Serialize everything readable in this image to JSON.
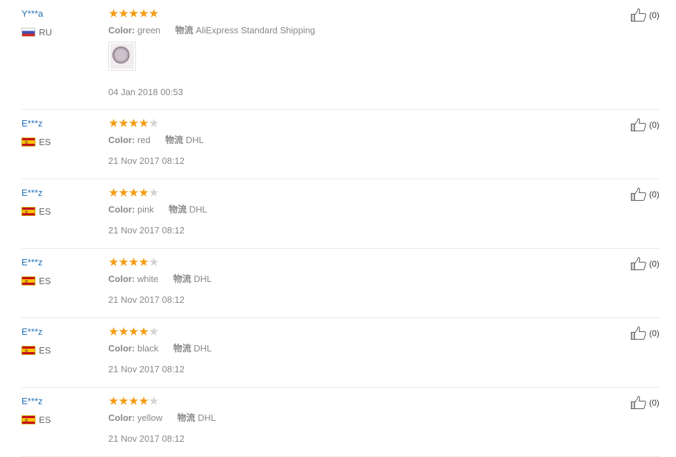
{
  "colors": {
    "accent_link": "#1f6fb6",
    "star_filled": "#f39c12",
    "star_empty": "#d4d4d4",
    "divider": "#e8e8e8"
  },
  "icons": {
    "helpful": "thumbs-up-icon",
    "photo": "review-photo",
    "star": "star-icon"
  },
  "reviews": [
    {
      "user": "Y***a",
      "country": "RU",
      "rating": 5,
      "color_label": "Color:",
      "color_value": "green",
      "shipping_label": "物流",
      "shipping_value": "AliExpress Standard Shipping",
      "date": "04 Jan 2018 00:53",
      "helpful": "(0)",
      "has_photo": true
    },
    {
      "user": "E***z",
      "country": "ES",
      "rating": 4,
      "color_label": "Color:",
      "color_value": "red",
      "shipping_label": "物流",
      "shipping_value": "DHL",
      "date": "21 Nov 2017 08:12",
      "helpful": "(0)",
      "has_photo": false
    },
    {
      "user": "E***z",
      "country": "ES",
      "rating": 4,
      "color_label": "Color:",
      "color_value": "pink",
      "shipping_label": "物流",
      "shipping_value": "DHL",
      "date": "21 Nov 2017 08:12",
      "helpful": "(0)",
      "has_photo": false
    },
    {
      "user": "E***z",
      "country": "ES",
      "rating": 4,
      "color_label": "Color:",
      "color_value": "white",
      "shipping_label": "物流",
      "shipping_value": "DHL",
      "date": "21 Nov 2017 08:12",
      "helpful": "(0)",
      "has_photo": false
    },
    {
      "user": "E***z",
      "country": "ES",
      "rating": 4,
      "color_label": "Color:",
      "color_value": "black",
      "shipping_label": "物流",
      "shipping_value": "DHL",
      "date": "21 Nov 2017 08:12",
      "helpful": "(0)",
      "has_photo": false
    },
    {
      "user": "E***z",
      "country": "ES",
      "rating": 4,
      "color_label": "Color:",
      "color_value": "yellow",
      "shipping_label": "物流",
      "shipping_value": "DHL",
      "date": "21 Nov 2017 08:12",
      "helpful": "(0)",
      "has_photo": false
    }
  ]
}
